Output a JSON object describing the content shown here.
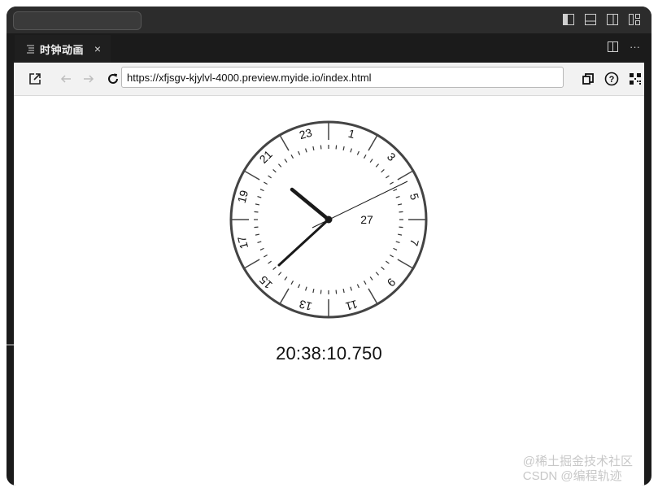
{
  "tab": {
    "title": "时钟动画",
    "close_glyph": "×"
  },
  "toolbar": {
    "url": "https://xfjsgv-kjylvl-4000.preview.myide.io/index.html"
  },
  "tabbar_more": "···",
  "clock": {
    "numbers": [
      "1",
      "3",
      "5",
      "7",
      "9",
      "11",
      "13",
      "15",
      "17",
      "19",
      "21",
      "23"
    ],
    "inner_number": "27",
    "time_text": "20:38:10.750"
  },
  "watermark": {
    "line1": "@稀土掘金技术社区",
    "line2": "CSDN @编程轨迹"
  },
  "colors": {
    "frame": "#1b1b1b",
    "accent": "#444444"
  }
}
